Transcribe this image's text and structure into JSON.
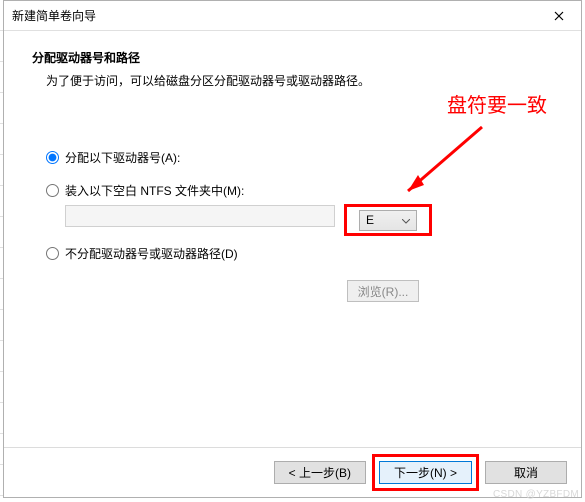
{
  "window": {
    "title": "新建简单卷向导"
  },
  "page": {
    "heading": "分配驱动器号和路径",
    "subheading": "为了便于访问，可以给磁盘分区分配驱动器号或驱动器路径。"
  },
  "annotation": {
    "text": "盘符要一致"
  },
  "options": {
    "assign_letter": {
      "label": "分配以下驱动器号(A):",
      "selected_value": "E"
    },
    "mount_folder": {
      "label": "装入以下空白 NTFS 文件夹中(M):",
      "path_value": "",
      "browse_label": "浏览(R)..."
    },
    "no_assign": {
      "label": "不分配驱动器号或驱动器路径(D)"
    }
  },
  "footer": {
    "back": "< 上一步(B)",
    "next": "下一步(N) >",
    "cancel": "取消"
  },
  "watermark": "CSDN @YZBFDM"
}
